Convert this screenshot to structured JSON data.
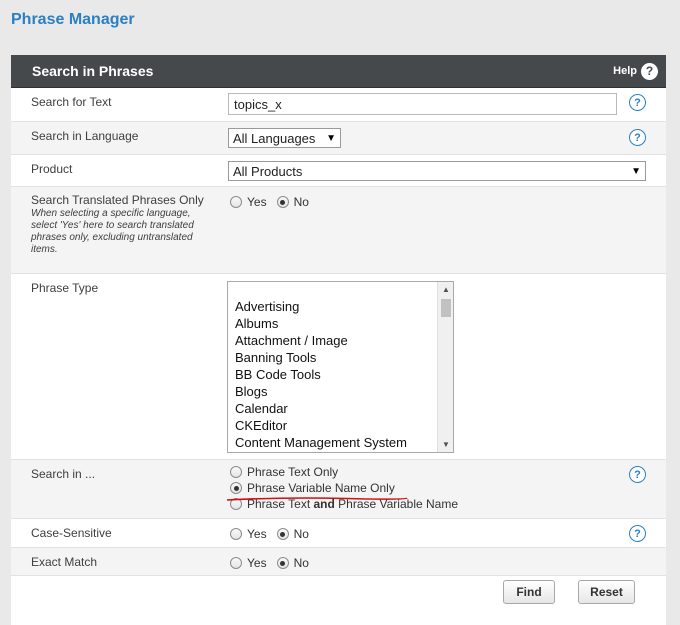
{
  "page": {
    "title": "Phrase Manager"
  },
  "panel": {
    "title": "Search in Phrases",
    "help_label": "Help",
    "help_icon": "?"
  },
  "rows": {
    "search_text": {
      "label": "Search for Text",
      "value": "topics_x"
    },
    "language": {
      "label": "Search in Language",
      "value": "All Languages"
    },
    "product": {
      "label": "Product",
      "value": "All Products"
    },
    "translated": {
      "label": "Search Translated Phrases Only",
      "desc": "When selecting a specific language, select 'Yes' here to search translated phrases only, excluding untranslated items.",
      "yes": "Yes",
      "no": "No",
      "selected": "No"
    },
    "phrase_type": {
      "label": "Phrase Type",
      "options": [
        "Advertising",
        "Albums",
        "Attachment / Image",
        "Banning Tools",
        "BB Code Tools",
        "Blogs",
        "Calendar",
        "CKEditor",
        "Content Management System"
      ]
    },
    "search_in": {
      "label": "Search in ...",
      "options": [
        "Phrase Text Only",
        "Phrase Variable Name Only"
      ],
      "option3_pre": "Phrase Text ",
      "option3_bold": "and",
      "option3_post": " Phrase Variable Name",
      "selected": "Phrase Variable Name Only"
    },
    "case_sensitive": {
      "label": "Case-Sensitive",
      "yes": "Yes",
      "no": "No",
      "selected": "No"
    },
    "exact_match": {
      "label": "Exact Match",
      "yes": "Yes",
      "no": "No",
      "selected": "No"
    }
  },
  "buttons": {
    "find": "Find",
    "reset": "Reset"
  },
  "colors": {
    "accent": "#2b7fc4",
    "header_bg": "#46494c",
    "annotation": "#d01010"
  }
}
